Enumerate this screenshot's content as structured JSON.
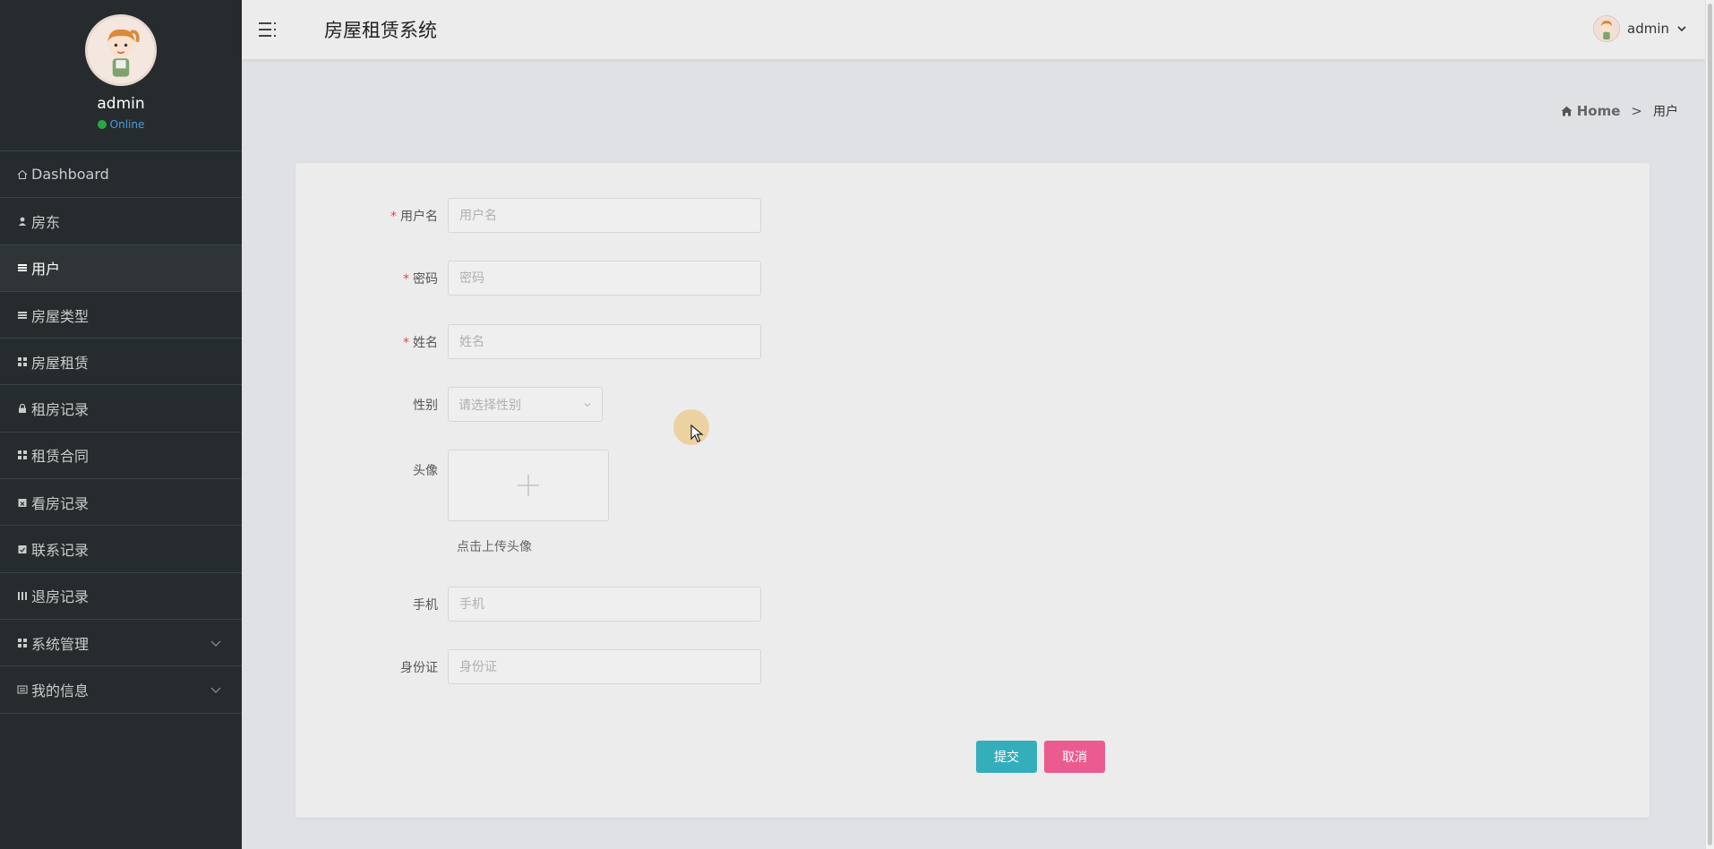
{
  "sidebar": {
    "profile": {
      "name": "admin",
      "status": "Online"
    },
    "items": [
      {
        "label": "Dashboard",
        "icon": "home-icon",
        "name": "sidebar-item-dashboard"
      },
      {
        "label": "房东",
        "icon": "user-icon",
        "name": "sidebar-item-landlord"
      },
      {
        "label": "用户",
        "icon": "list-icon",
        "name": "sidebar-item-users",
        "active": true
      },
      {
        "label": "房屋类型",
        "icon": "list-icon",
        "name": "sidebar-item-house-types"
      },
      {
        "label": "房屋租赁",
        "icon": "grid-icon",
        "name": "sidebar-item-house-rental"
      },
      {
        "label": "租房记录",
        "icon": "lock-icon",
        "name": "sidebar-item-rental-records"
      },
      {
        "label": "租赁合同",
        "icon": "grid-icon",
        "name": "sidebar-item-lease-contracts"
      },
      {
        "label": "看房记录",
        "icon": "calendar-x-icon",
        "name": "sidebar-item-viewing-records"
      },
      {
        "label": "联系记录",
        "icon": "calendar-check-icon",
        "name": "sidebar-item-contact-records"
      },
      {
        "label": "退房记录",
        "icon": "columns-icon",
        "name": "sidebar-item-checkout-records"
      },
      {
        "label": "系统管理",
        "icon": "grid-icon",
        "name": "sidebar-item-system-management",
        "expandable": true
      },
      {
        "label": "我的信息",
        "icon": "id-card-icon",
        "name": "sidebar-item-my-info",
        "expandable": true
      }
    ]
  },
  "header": {
    "title": "房屋租赁系统",
    "user": "admin"
  },
  "breadcrumb": {
    "home": "Home",
    "separator": ">",
    "current": "用户"
  },
  "form": {
    "username": {
      "label": "用户名",
      "placeholder": "用户名",
      "required": true,
      "value": ""
    },
    "password": {
      "label": "密码",
      "placeholder": "密码",
      "required": true,
      "value": ""
    },
    "name": {
      "label": "姓名",
      "placeholder": "姓名",
      "required": true,
      "value": ""
    },
    "gender": {
      "label": "性别",
      "placeholder": "请选择性别",
      "required": false
    },
    "avatar": {
      "label": "头像",
      "hint": "点击上传头像"
    },
    "phone": {
      "label": "手机",
      "placeholder": "手机",
      "required": false,
      "value": ""
    },
    "id_card": {
      "label": "身份证",
      "placeholder": "身份证",
      "required": false,
      "value": ""
    },
    "submit_label": "提交",
    "cancel_label": "取消"
  },
  "colors": {
    "sidebar_bg": "#262c2d",
    "submit": "#35aebc",
    "cancel": "#ec5b8f",
    "required": "#e34a4a",
    "online": "#28a745"
  }
}
